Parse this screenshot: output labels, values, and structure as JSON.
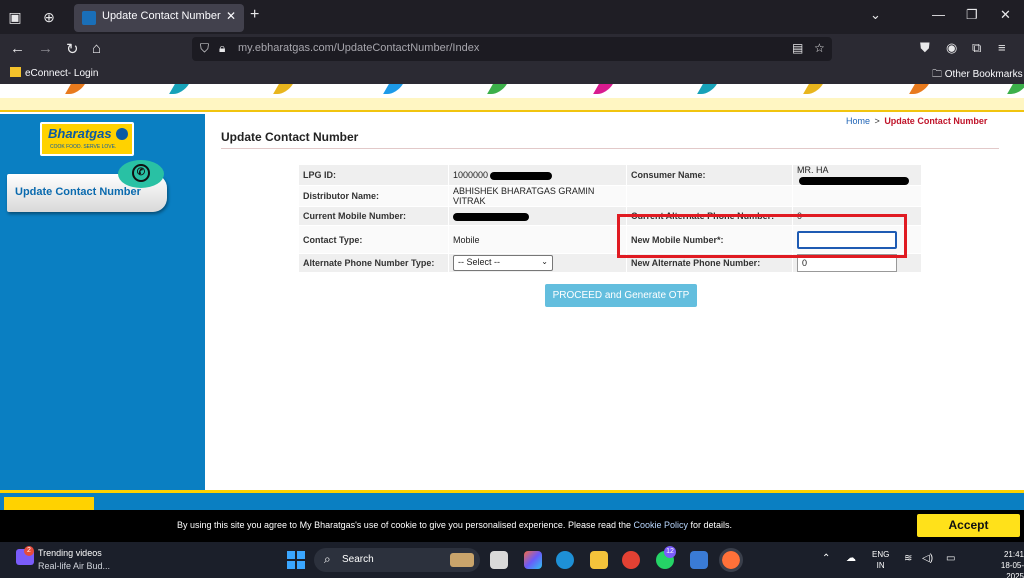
{
  "browser": {
    "tab_title": "Update Contact Number",
    "url_host": "my.ebharatgas.com",
    "url_path": "/UpdateContactNumber/Index",
    "bookmarks": [
      "eConnect- Login"
    ],
    "other_bookmarks": "Other Bookmarks"
  },
  "sidebar": {
    "logo_text": "Bharatgas",
    "logo_tagline": "COOK FOOD. SERVE LOVE.",
    "active_item": "Update Contact Number"
  },
  "breadcrumb": {
    "home": "Home",
    "separator": ">",
    "current": "Update Contact Number"
  },
  "page_title": "Update Contact Number",
  "form": {
    "lpg_id_label": "LPG ID:",
    "lpg_id_value": "1000000",
    "consumer_name_label": "Consumer Name:",
    "consumer_name_value": "MR. HA",
    "distributor_label": "Distributor Name:",
    "distributor_value": "ABHISHEK BHARATGAS GRAMIN VITRAK",
    "current_mobile_label": "Current Mobile Number:",
    "current_alt_label": "Current Alternate Phone Number:",
    "current_alt_value": "0",
    "contact_type_label": "Contact Type:",
    "contact_type_value": "Mobile",
    "new_mobile_label": "New Mobile Number*:",
    "new_mobile_value": "",
    "alt_type_label": "Alternate Phone Number Type:",
    "alt_type_selected": "-- Select --",
    "new_alt_label": "New Alternate Phone Number:",
    "new_alt_value": "0",
    "submit_label": "PROCEED and Generate OTP"
  },
  "cookie": {
    "text_before": "By using this site you agree to My Bharatgas's use of cookie to give you personalised experience. Please read the ",
    "link": "Cookie Policy",
    "text_after": " for details.",
    "accept_label": "Accept"
  },
  "taskbar": {
    "widget_badge": "2",
    "trending_title": "Trending videos",
    "trending_sub": "Real-life Air Bud...",
    "search_label": "Search",
    "whatsapp_badge": "12",
    "lang_line1": "ENG",
    "lang_line2": "IN",
    "time": "21:41",
    "date": "18-05-2025"
  },
  "colors": {
    "brand_blue": "#0a7fc2",
    "brand_yellow": "#ffd200",
    "error_red": "#e01b22",
    "accept_yellow": "#ffe11a",
    "button_blue": "#63bede"
  }
}
